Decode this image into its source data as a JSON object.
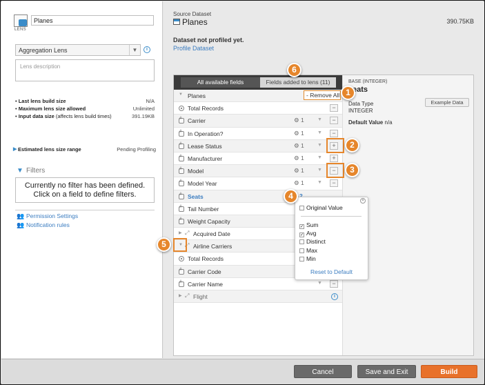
{
  "lens": {
    "name": "Planes",
    "icon_caption": "LENS",
    "type": "Aggregation Lens",
    "description_placeholder": "Lens description"
  },
  "stats": [
    {
      "label": "Last lens build size",
      "note": "",
      "value": "N/A"
    },
    {
      "label": "Maximum lens size allowed",
      "note": "",
      "value": "Unlimited"
    },
    {
      "label": "Input data size",
      "note": "(affects lens build times)",
      "value": "391.19KB"
    }
  ],
  "estimated": {
    "label": "Estimated lens size range",
    "value": "Pending Profiling"
  },
  "filters": {
    "header": "Filters",
    "empty_line1": "Currently no filter has been defined.",
    "empty_line2": "Click on a field to define filters."
  },
  "links": {
    "permission": "Permission Settings",
    "notification": "Notification rules"
  },
  "source": {
    "label": "Source Dataset",
    "name": "Planes",
    "size": "390.75KB",
    "not_profiled": "Dataset not profiled yet.",
    "profile_link": "Profile Dataset"
  },
  "tabs": {
    "all": "All available fields",
    "added": "Fields added to lens (11)"
  },
  "fields": {
    "planes": "Planes",
    "remove_all": "- Remove All",
    "total_records": "Total Records",
    "carrier": "Carrier",
    "in_operation": "In Operation?",
    "lease_status": "Lease Status",
    "manufacturer": "Manufacturer",
    "model": "Model",
    "model_year": "Model Year",
    "seats": "Seats",
    "tail_number": "Tail Number",
    "weight_capacity": "Weight Capacity",
    "acquired_date": "Acquired Date",
    "airline_carriers": "Airline Carriers",
    "total_records2": "Total Records",
    "carrier_code": "Carrier Code",
    "carrier_name": "Carrier Name",
    "flight": "Flight",
    "gear_value": "1",
    "seats_count": "2"
  },
  "detail": {
    "base": "BASE (INTEGER)",
    "name": "eats",
    "data_type_label": "Data Type",
    "data_type": "INTEGER",
    "default_label": "Default Value",
    "default_value": "n/a",
    "example_button": "Example Data"
  },
  "popover": {
    "original": "Original Value",
    "sum": "Sum",
    "avg": "Avg",
    "distinct": "Distinct",
    "max": "Max",
    "min": "Min",
    "reset": "Reset to Default",
    "checked": {
      "original": false,
      "sum": true,
      "avg": true,
      "distinct": false,
      "max": false,
      "min": false
    }
  },
  "callouts": [
    "1",
    "2",
    "3",
    "4",
    "5",
    "6"
  ],
  "footer": {
    "cancel": "Cancel",
    "save": "Save and Exit",
    "build": "Build"
  },
  "colors": {
    "accent": "#e8712a",
    "link": "#3a7cc0",
    "callout": "#e6862b"
  }
}
